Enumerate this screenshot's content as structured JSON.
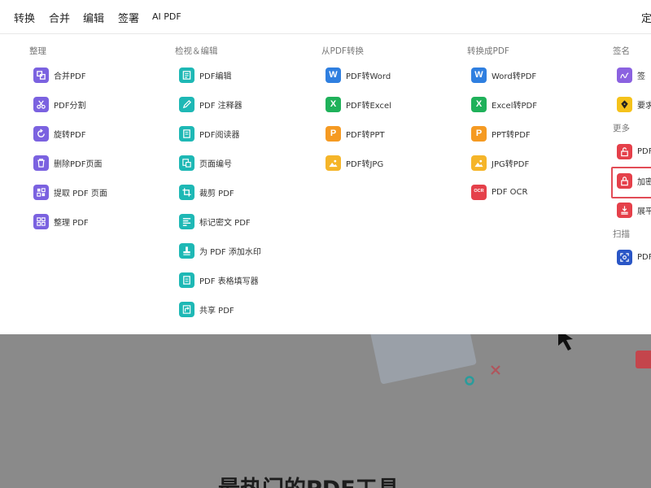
{
  "topnav": {
    "items": [
      "转换",
      "合并",
      "编辑",
      "签署",
      "AI PDF"
    ],
    "right": "定"
  },
  "columns": {
    "organize": {
      "title": "整理",
      "items": [
        "合并PDF",
        "PDF分割",
        "旋转PDF",
        "删除PDF页面",
        "提取 PDF 页面",
        "整理 PDF"
      ]
    },
    "view_edit": {
      "title": "检视＆编辑",
      "items": [
        "PDF编辑",
        "PDF 注释器",
        "PDF阅读器",
        "页面编号",
        "裁剪 PDF",
        "标记密文 PDF",
        "为 PDF 添加水印",
        "PDF 表格填写器",
        "共享 PDF"
      ]
    },
    "from_pdf": {
      "title": "从PDF转换",
      "items": [
        "PDF转Word",
        "PDF转Excel",
        "PDF转PPT",
        "PDF转JPG"
      ]
    },
    "to_pdf": {
      "title": "转换成PDF",
      "items": [
        "Word转PDF",
        "Excel转PDF",
        "PPT转PDF",
        "JPG转PDF",
        "PDF OCR"
      ]
    },
    "sign": {
      "title": "签名",
      "items": [
        "签",
        "要求"
      ],
      "more_title": "更多",
      "more_items": [
        "PDF",
        "加密",
        "展平"
      ],
      "scan_title": "扫描",
      "scan_items": [
        "PDF"
      ]
    }
  },
  "icons": {
    "word": "W",
    "excel": "X",
    "ppt": "P",
    "ocr": "OCR"
  },
  "hero": {
    "title": "最热门的PDF工具"
  },
  "colors": {
    "purple": "#7b62e0",
    "teal": "#1eb8b5",
    "blue": "#2f7fe0",
    "green": "#1fb15a",
    "orange": "#f59a22",
    "red": "#e5404a",
    "darkblue": "#2a56c6",
    "highlight": "#e24c56"
  }
}
